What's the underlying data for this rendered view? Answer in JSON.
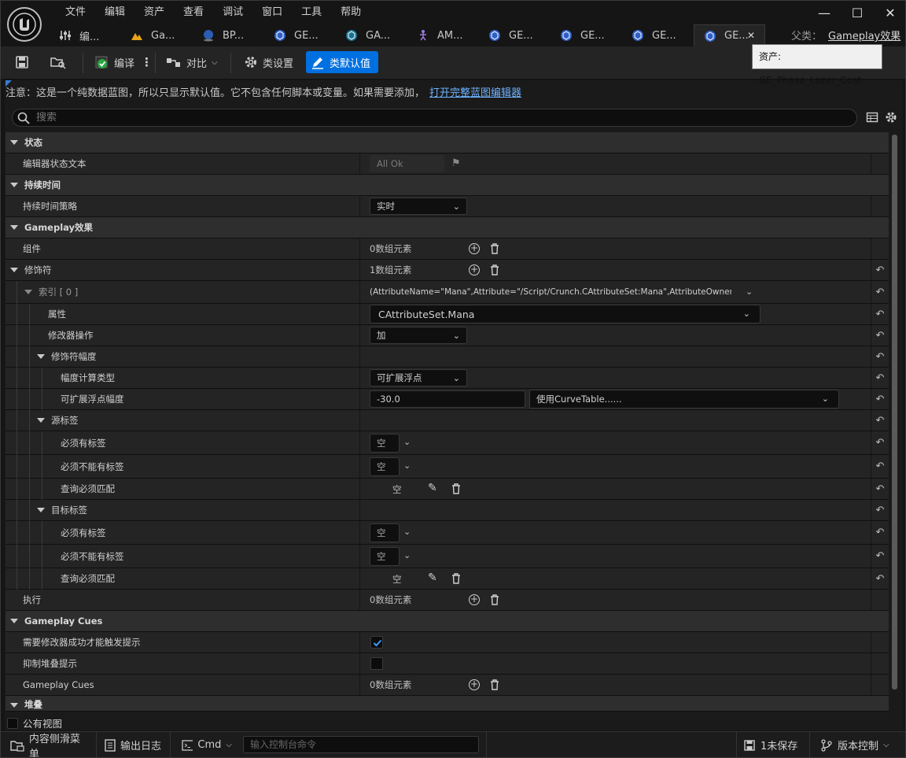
{
  "menu": [
    "文件",
    "编辑",
    "资产",
    "查看",
    "调试",
    "窗口",
    "工具",
    "帮助"
  ],
  "tabs": [
    {
      "label": "编...",
      "icon": "sliders-icon"
    },
    {
      "label": "Ga...",
      "icon": "landscape-icon"
    },
    {
      "label": "BP...",
      "icon": "sphere-icon"
    },
    {
      "label": "GE...",
      "icon": "gameplay-effect-icon"
    },
    {
      "label": "GA...",
      "icon": "gameplay-ability-icon"
    },
    {
      "label": "AM...",
      "icon": "anim-montage-icon"
    },
    {
      "label": "GE...",
      "icon": "gameplay-effect-icon"
    },
    {
      "label": "GE...",
      "icon": "gameplay-effect-icon"
    },
    {
      "label": "GE...",
      "icon": "gameplay-effect-icon"
    },
    {
      "label": "GE...",
      "icon": "gameplay-effect-icon",
      "active": true
    }
  ],
  "parent": {
    "label": "父类：",
    "value": "Gameplay效果"
  },
  "tooltip": "资产: GE_Phase_Lazer_Cost",
  "toolbar": {
    "compile": "编译",
    "diff": "对比",
    "class_settings": "类设置",
    "class_defaults": "类默认值"
  },
  "notice": {
    "text": "注意：这是一个纯数据蓝图，所以只显示默认值。它不包含任何脚本或变量。如果需要添加，",
    "link": "打开完整蓝图编辑器"
  },
  "search_placeholder": "搜索",
  "rows": {
    "status_cat": "状态",
    "editor_status": "编辑器状态文本",
    "editor_status_val": "All Ok",
    "duration_cat": "持续时间",
    "duration_policy": "持续时间策略",
    "duration_policy_val": "实时",
    "gameplay_cat": "Gameplay效果",
    "components": "组件",
    "components_val": "0数组元素",
    "modifiers": "修饰符",
    "modifiers_val": "1数组元素",
    "index0": "索引 [ 0 ]",
    "index0_val": "(AttributeName=\"Mana\",Attribute=\"/Script/Crunch.CAttributeSet:Mana\",AttributeOwner=\"/Sc",
    "attribute": "属性",
    "attribute_val": "CAttributeSet.Mana",
    "mod_op": "修改器操作",
    "mod_op_val": "加",
    "magnitude": "修饰符幅度",
    "calc_type": "幅度计算类型",
    "calc_type_val": "可扩展浮点",
    "scalable": "可扩展浮点幅度",
    "scalable_val": "-30.0",
    "curve_val": "使用CurveTable......",
    "source_tags": "源标签",
    "req_tags": "必须有标签",
    "ign_tags": "必须不能有标签",
    "query": "查询必须匹配",
    "empty": "空",
    "target_tags": "目标标签",
    "executions": "执行",
    "executions_val": "0数组元素",
    "cues_cat": "Gameplay Cues",
    "require_success": "需要修改器成功才能触发提示",
    "suppress_stack": "抑制堆叠提示",
    "cues": "Gameplay Cues",
    "cues_val": "0数组元素",
    "stacking_cat": "堆叠"
  },
  "public_view": "公有视图",
  "status": {
    "content_drawer": "内容侧滑菜单",
    "output_log": "输出日志",
    "cmd": "Cmd",
    "console_placeholder": "输入控制台命令",
    "unsaved": "1未保存",
    "source_control": "版本控制"
  }
}
